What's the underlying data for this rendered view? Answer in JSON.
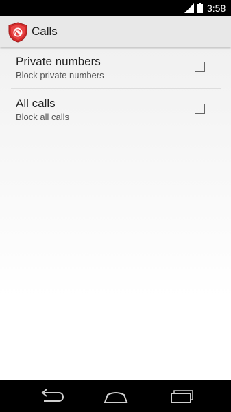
{
  "status_bar": {
    "time": "3:58",
    "icons": [
      "signal-icon",
      "battery-icon"
    ]
  },
  "action_bar": {
    "title": "Calls",
    "icon": "shield-icon"
  },
  "preferences": [
    {
      "title": "Private numbers",
      "summary": "Block private numbers",
      "checked": false
    },
    {
      "title": "All calls",
      "summary": "Block all calls",
      "checked": false
    }
  ],
  "nav_bar": {
    "icons": [
      "back-icon",
      "home-icon",
      "recents-icon"
    ]
  },
  "colors": {
    "status_bar": "#000000",
    "action_bar": "#e8e8e8",
    "shield": "#d22b2b",
    "text_primary": "#222222",
    "text_secondary": "#555555"
  }
}
